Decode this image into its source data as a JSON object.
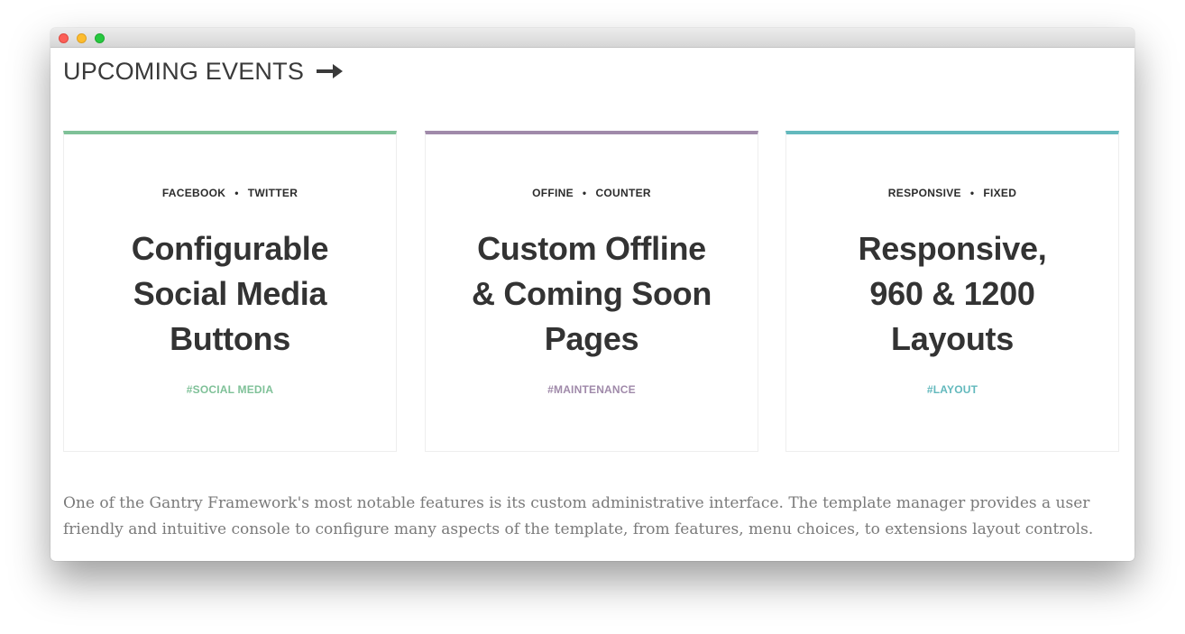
{
  "section": {
    "title": "UPCOMING EVENTS",
    "arrow_icon": "arrow-right-icon"
  },
  "cards": [
    {
      "tag_1": "FACEBOOK",
      "tag_2": "TWITTER",
      "separator": "•",
      "headline_lines": [
        "Configurable",
        "Social Media",
        "Buttons"
      ],
      "hashtag": "#SOCIAL MEDIA",
      "accent": "#7fc198"
    },
    {
      "tag_1": "OFFINE",
      "tag_2": "COUNTER",
      "separator": "•",
      "headline_lines": [
        "Custom Offline",
        "& Coming Soon",
        "Pages"
      ],
      "hashtag": "#MAINTENANCE",
      "accent": "#a08aaa"
    },
    {
      "tag_1": "RESPONSIVE",
      "tag_2": "FIXED",
      "separator": "•",
      "headline_lines": [
        "Responsive,",
        "960 & 1200",
        "Layouts"
      ],
      "hashtag": "#LAYOUT",
      "accent": "#63b9bd"
    }
  ],
  "description": "One of the Gantry Framework's most notable features is its custom administrative interface. The template manager provides a user friendly and intuitive console to configure many aspects of the template, from features, menu choices, to extensions layout controls."
}
